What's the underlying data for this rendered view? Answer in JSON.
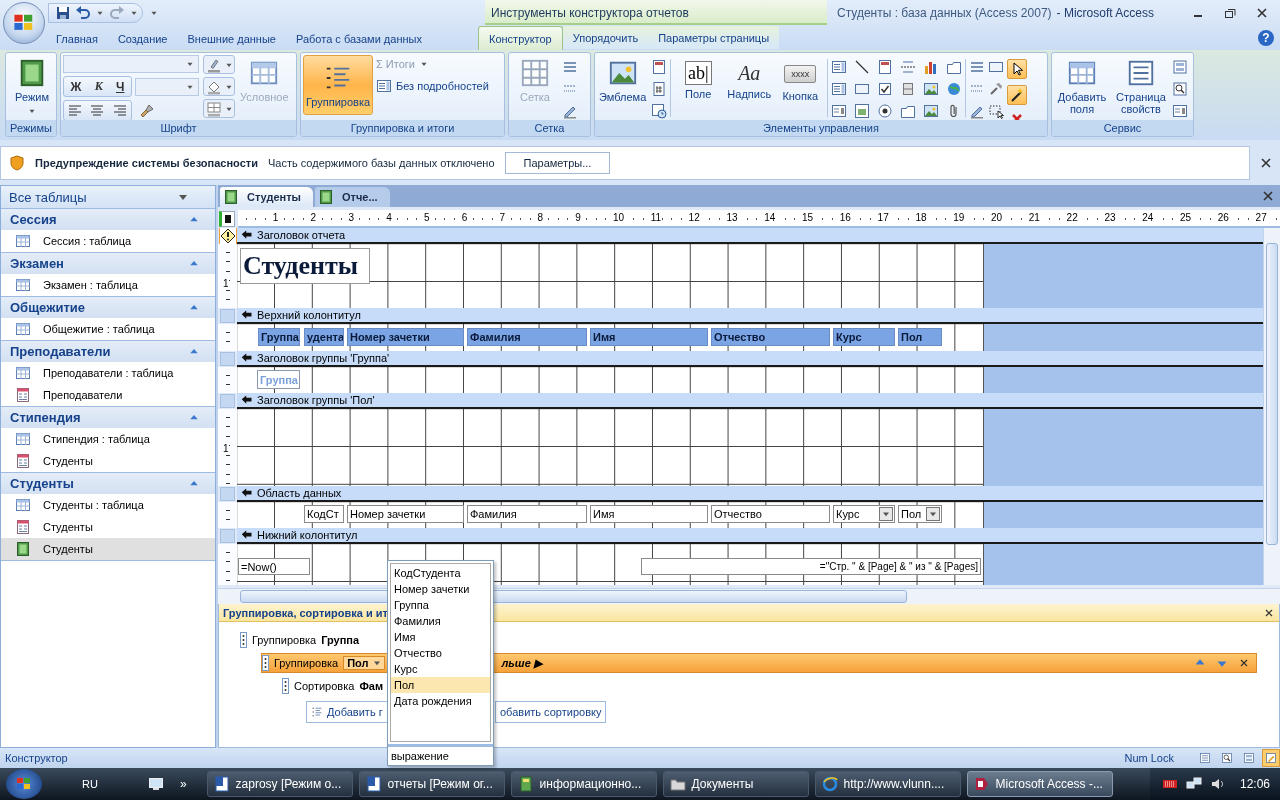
{
  "window": {
    "title": "Студенты : база данных (Access 2007)",
    "app_name": "- Microsoft Access",
    "context_tools": "Инструменты конструктора отчетов",
    "help": "?"
  },
  "ribbon_tabs": [
    {
      "label": "Главная",
      "selected": false,
      "contextual": false
    },
    {
      "label": "Создание",
      "selected": false,
      "contextual": false
    },
    {
      "label": "Внешние данные",
      "selected": false,
      "contextual": false
    },
    {
      "label": "Работа с базами данных",
      "selected": false,
      "contextual": false
    },
    {
      "label": "Конструктор",
      "selected": true,
      "contextual": true
    },
    {
      "label": "Упорядочить",
      "selected": false,
      "contextual": true
    },
    {
      "label": "Параметры страницы",
      "selected": false,
      "contextual": true
    }
  ],
  "ribbon_groups": [
    {
      "kind": "views",
      "label": "Режимы",
      "main": {
        "label": "Режим"
      }
    },
    {
      "kind": "font",
      "label": "Шрифт",
      "style_buttons": [
        "Ж",
        "К",
        "Ч"
      ],
      "conditional": {
        "label": "Условное",
        "disabled": true
      }
    },
    {
      "kind": "grouping",
      "label": "Группировка и итоги",
      "main": {
        "label": "Группировка",
        "selected": true
      },
      "totals": {
        "glyph": "Σ",
        "label": "Итоги",
        "disabled": true
      },
      "hide_details": {
        "label": "Без подробностей"
      }
    },
    {
      "kind": "grid",
      "label": "Сетка",
      "main": {
        "label": "Сетка",
        "disabled": true
      }
    },
    {
      "kind": "controls",
      "label": "Элементы управления",
      "logo": {
        "label": "Эмблема"
      },
      "tools": [
        {
          "glyph": "ab|",
          "label": "Поле"
        },
        {
          "glyph": "Aa",
          "label": "Надпись"
        },
        {
          "glyph": "xxxx",
          "label": "Кнопка"
        }
      ],
      "select_tool": {
        "selected": true
      },
      "wizards": {
        "selected": true
      }
    },
    {
      "kind": "tools",
      "label": "Сервис",
      "buttons": [
        {
          "label": "Добавить поля"
        },
        {
          "label": "Страница свойств"
        }
      ]
    }
  ],
  "security_bar": {
    "title": "Предупреждение системы безопасности",
    "message": "Часть содержимого базы данных отключено",
    "button": "Параметры..."
  },
  "navigation": {
    "header": "Все таблицы",
    "groups": [
      {
        "label": "Сессия",
        "items": [
          {
            "label": "Сессия : таблица",
            "kind": "table",
            "selected": false
          }
        ]
      },
      {
        "label": "Экзамен",
        "items": [
          {
            "label": "Экзамен : таблица",
            "kind": "table",
            "selected": false
          }
        ]
      },
      {
        "label": "Общежитие",
        "items": [
          {
            "label": "Общежитие : таблица",
            "kind": "table",
            "selected": false
          }
        ]
      },
      {
        "label": "Преподаватели",
        "items": [
          {
            "label": "Преподаватели : таблица",
            "kind": "table",
            "selected": false
          },
          {
            "label": "Преподаватели",
            "kind": "form",
            "selected": false
          }
        ]
      },
      {
        "label": "Стипендия",
        "items": [
          {
            "label": "Стипендия : таблица",
            "kind": "table",
            "selected": false
          },
          {
            "label": "Студенты",
            "kind": "form",
            "selected": false
          }
        ]
      },
      {
        "label": "Студенты",
        "items": [
          {
            "label": "Студенты : таблица",
            "kind": "table",
            "selected": false
          },
          {
            "label": "Студенты",
            "kind": "form",
            "selected": false
          },
          {
            "label": "Студенты",
            "kind": "report",
            "selected": true
          }
        ]
      }
    ]
  },
  "document_tabs": [
    {
      "label": "Студенты",
      "selected": true
    },
    {
      "label": "Отче...",
      "selected": false
    }
  ],
  "ruler": [
    "1",
    "2",
    "3",
    "4",
    "5",
    "6",
    "7",
    "8",
    "9",
    "10",
    "11",
    "12",
    "13",
    "14",
    "15",
    "16",
    "17",
    "18",
    "19",
    "20",
    "21",
    "22",
    "23",
    "24",
    "25",
    "26",
    "27"
  ],
  "sections": [
    {
      "title": "Заголовок отчета",
      "warning": true,
      "ruler_label": "1",
      "controls": [
        {
          "kind": "title",
          "label": "Студенты"
        }
      ]
    },
    {
      "title": "Верхний колонтитул",
      "warning": false,
      "controls": [
        {
          "kind": "heading",
          "label": "Группа"
        },
        {
          "kind": "heading",
          "label": "удента"
        },
        {
          "kind": "heading",
          "label": "Номер зачетки"
        },
        {
          "kind": "heading",
          "label": "Фамилия"
        },
        {
          "kind": "heading",
          "label": "Имя"
        },
        {
          "kind": "heading",
          "label": "Отчество"
        },
        {
          "kind": "heading",
          "label": "Курс"
        },
        {
          "kind": "heading",
          "label": "Пол"
        }
      ]
    },
    {
      "title": "Заголовок группы 'Группа'",
      "warning": false,
      "controls": [
        {
          "kind": "group-field",
          "label": "Группа"
        }
      ]
    },
    {
      "title": "Заголовок группы 'Пол'",
      "warning": false,
      "ruler_label": "1"
    },
    {
      "title": "Область данных",
      "warning": false,
      "controls": [
        {
          "kind": "field",
          "label": "КодСт"
        },
        {
          "kind": "field",
          "label": "Номер зачетки"
        },
        {
          "kind": "field",
          "label": "Фамилия"
        },
        {
          "kind": "field",
          "label": "Имя"
        },
        {
          "kind": "field",
          "label": "Отчество"
        },
        {
          "kind": "combo",
          "label": "Курс"
        },
        {
          "kind": "combo",
          "label": "Пол"
        }
      ]
    },
    {
      "title": "Нижний колонтитул",
      "warning": false,
      "controls": [
        {
          "kind": "field",
          "label": "=Now()"
        },
        {
          "kind": "expression",
          "label": "=\"Стр. \" & [Page] & \" из \" & [Pages]"
        }
      ]
    }
  ],
  "grouping_pane": {
    "title": "Группировка, сортировка и ит",
    "levels": [
      {
        "label": "Группировка",
        "field": "Группа",
        "selected": false,
        "children": [
          {
            "label": "Группировка",
            "field": "Пол",
            "more": "льше ▶",
            "selected": true,
            "children": [
              {
                "label": "Сортировка",
                "field": "Фам",
                "selected": false
              }
            ]
          }
        ]
      }
    ],
    "add_buttons": [
      "Добавить г",
      "обавить сортировку"
    ]
  },
  "field_dropdown": {
    "items": [
      {
        "label": "КодСтудента",
        "selected": false
      },
      {
        "label": "Номер зачетки",
        "selected": false
      },
      {
        "label": "Группа",
        "selected": false
      },
      {
        "label": "Фамилия",
        "selected": false
      },
      {
        "label": "Имя",
        "selected": false
      },
      {
        "label": "Отчество",
        "selected": false
      },
      {
        "label": "Курс",
        "selected": false
      },
      {
        "label": "Пол",
        "selected": true
      },
      {
        "label": "Дата рождения",
        "selected": false
      }
    ],
    "footer": "выражение"
  },
  "status_bar": {
    "mode": "Конструктор",
    "indicator": "Num Lock",
    "views": [
      {
        "selected": false
      },
      {
        "selected": false
      },
      {
        "selected": false
      },
      {
        "selected": true
      }
    ]
  },
  "taskbar": {
    "language": "RU",
    "more": "»",
    "tasks": [
      {
        "label": "zaprosy [Режим о...",
        "kind": "word",
        "selected": false
      },
      {
        "label": "отчеты [Режим ог...",
        "kind": "word",
        "selected": false
      },
      {
        "label": "информационно...",
        "kind": "book",
        "selected": false
      },
      {
        "label": "Документы",
        "kind": "folder",
        "selected": false
      },
      {
        "label": "http://www.vlunn....",
        "kind": "browser",
        "selected": false
      },
      {
        "label": "Microsoft Access -...",
        "kind": "access",
        "selected": true
      }
    ],
    "clock": "12:06"
  }
}
